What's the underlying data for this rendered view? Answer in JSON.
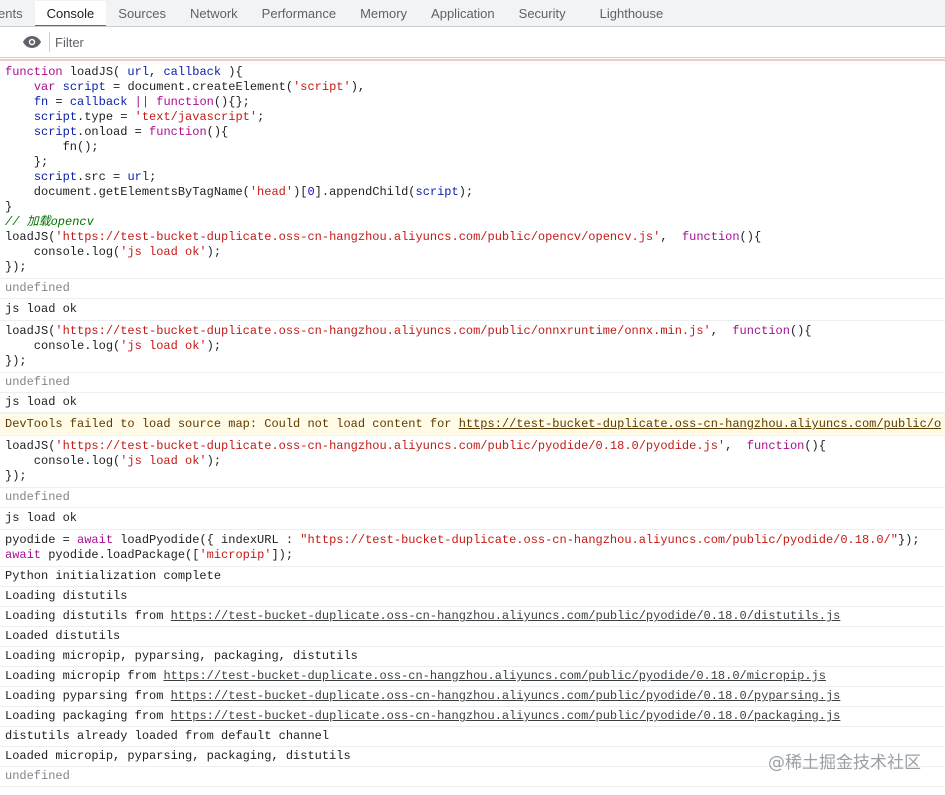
{
  "tabs": [
    {
      "label": "ents",
      "active": false
    },
    {
      "label": "Console",
      "active": true
    },
    {
      "label": "Sources",
      "active": false
    },
    {
      "label": "Network",
      "active": false
    },
    {
      "label": "Performance",
      "active": false
    },
    {
      "label": "Memory",
      "active": false
    },
    {
      "label": "Application",
      "active": false
    },
    {
      "label": "Security",
      "active": false
    },
    {
      "label": "Lighthouse",
      "active": false
    }
  ],
  "toolbar": {
    "filter_placeholder": "Filter",
    "eye_icon": "eye-icon"
  },
  "console": {
    "input1": [
      [
        "kw",
        "function"
      ],
      [
        "t",
        " loadJS( "
      ],
      [
        "prop",
        "url"
      ],
      [
        "t",
        ", "
      ],
      [
        "prop",
        "callback"
      ],
      [
        "t",
        " ){\n    "
      ],
      [
        "kw",
        "var"
      ],
      [
        "t",
        " "
      ],
      [
        "prop",
        "script"
      ],
      [
        "t",
        " = document.createElement("
      ],
      [
        "str",
        "'script'"
      ],
      [
        "t",
        "),\n    "
      ],
      [
        "prop",
        "fn"
      ],
      [
        "t",
        " = "
      ],
      [
        "prop",
        "callback"
      ],
      [
        "t",
        " "
      ],
      [
        "kw",
        "||"
      ],
      [
        "t",
        " "
      ],
      [
        "kw",
        "function"
      ],
      [
        "t",
        "(){};\n    "
      ],
      [
        "prop",
        "script"
      ],
      [
        "t",
        ".type = "
      ],
      [
        "str",
        "'text/javascript'"
      ],
      [
        "t",
        ";\n    "
      ],
      [
        "prop",
        "script"
      ],
      [
        "t",
        ".onload = "
      ],
      [
        "kw",
        "function"
      ],
      [
        "t",
        "(){\n        fn();\n    };\n    "
      ],
      [
        "prop",
        "script"
      ],
      [
        "t",
        ".src = "
      ],
      [
        "prop",
        "url"
      ],
      [
        "t",
        ";\n    document.getElementsByTagName("
      ],
      [
        "str",
        "'head'"
      ],
      [
        "t",
        ")["
      ],
      [
        "num",
        "0"
      ],
      [
        "t",
        "].appendChild("
      ],
      [
        "prop",
        "script"
      ],
      [
        "t",
        ");\n}\n"
      ],
      [
        "cm",
        "// 加载opencv"
      ],
      [
        "t",
        "\nloadJS("
      ],
      [
        "str",
        "'https://test-bucket-duplicate.oss-cn-hangzhou.aliyuncs.com/public/opencv/opencv.js'"
      ],
      [
        "t",
        ",  "
      ],
      [
        "kw",
        "function"
      ],
      [
        "t",
        "(){\n    console.log("
      ],
      [
        "str",
        "'js load ok'"
      ],
      [
        "t",
        ");\n});"
      ]
    ],
    "result1": "undefined",
    "log1": "js load ok",
    "input2": [
      [
        "t",
        "loadJS("
      ],
      [
        "str",
        "'https://test-bucket-duplicate.oss-cn-hangzhou.aliyuncs.com/public/onnxruntime/onnx.min.js'"
      ],
      [
        "t",
        ",  "
      ],
      [
        "kw",
        "function"
      ],
      [
        "t",
        "(){\n    console.log("
      ],
      [
        "str",
        "'js load ok'"
      ],
      [
        "t",
        ");\n});"
      ]
    ],
    "result2": "undefined",
    "log2": "js load ok",
    "warning_text": "DevTools failed to load source map: Could not load content for ",
    "warning_link": "https://test-bucket-duplicate.oss-cn-hangzhou.aliyuncs.com/public/o",
    "input3": [
      [
        "t",
        "loadJS("
      ],
      [
        "str",
        "'https://test-bucket-duplicate.oss-cn-hangzhou.aliyuncs.com/public/pyodide/0.18.0/pyodide.js'"
      ],
      [
        "t",
        ",  "
      ],
      [
        "kw",
        "function"
      ],
      [
        "t",
        "(){\n    console.log("
      ],
      [
        "str",
        "'js load ok'"
      ],
      [
        "t",
        ");\n});"
      ]
    ],
    "result3": "undefined",
    "log3": "js load ok",
    "input4": [
      [
        "t",
        "pyodide = "
      ],
      [
        "kw",
        "await"
      ],
      [
        "t",
        " loadPyodide({ indexURL : "
      ],
      [
        "str",
        "\"https://test-bucket-duplicate.oss-cn-hangzhou.aliyuncs.com/public/pyodide/0.18.0/\""
      ],
      [
        "t",
        "});\n"
      ],
      [
        "kw",
        "await"
      ],
      [
        "t",
        " pyodide.loadPackage(["
      ],
      [
        "str",
        "'micropip'"
      ],
      [
        "t",
        "]);"
      ]
    ],
    "logs": [
      {
        "text": "Python initialization complete",
        "link": ""
      },
      {
        "text": "Loading distutils",
        "link": ""
      },
      {
        "text": "Loading distutils from ",
        "link": "https://test-bucket-duplicate.oss-cn-hangzhou.aliyuncs.com/public/pyodide/0.18.0/distutils.js"
      },
      {
        "text": "Loaded distutils",
        "link": ""
      },
      {
        "text": "Loading micropip, pyparsing, packaging, distutils",
        "link": ""
      },
      {
        "text": "Loading micropip from ",
        "link": "https://test-bucket-duplicate.oss-cn-hangzhou.aliyuncs.com/public/pyodide/0.18.0/micropip.js"
      },
      {
        "text": "Loading pyparsing from ",
        "link": "https://test-bucket-duplicate.oss-cn-hangzhou.aliyuncs.com/public/pyodide/0.18.0/pyparsing.js"
      },
      {
        "text": "Loading packaging from ",
        "link": "https://test-bucket-duplicate.oss-cn-hangzhou.aliyuncs.com/public/pyodide/0.18.0/packaging.js"
      },
      {
        "text": "distutils already loaded from default channel",
        "link": ""
      },
      {
        "text": "Loaded micropip, pyparsing, packaging, distutils",
        "link": ""
      }
    ],
    "result4": "undefined"
  },
  "watermark": "@稀土掘金技术社区"
}
